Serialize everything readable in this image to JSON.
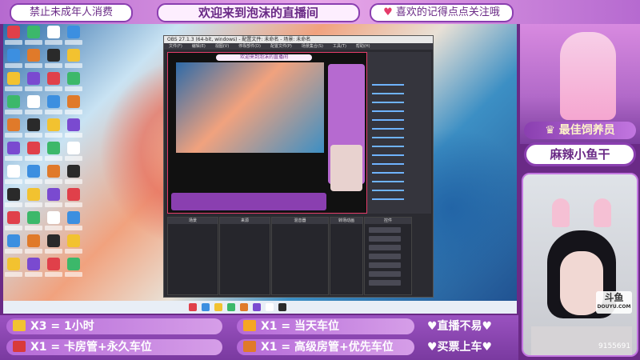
{
  "overlay": {
    "top_left_text": "禁止未成年人消费",
    "top_center_text": "欢迎来到泡沫的直播间",
    "top_right_text": "喜欢的记得点点关注哦",
    "best_fan_title": "最佳饲养员",
    "best_fan_name": "麻辣小鱼干",
    "platform_logo": "斗鱼",
    "platform_sub": "DOUYU.COM",
    "corner_number": "9155691"
  },
  "gifts": [
    {
      "icon": "gold-bar-icon",
      "text": "X3 = 1小时",
      "color": "#f2c230"
    },
    {
      "icon": "rocket-icon",
      "text": "X1 = 卡房管+永久车位",
      "color": "#d93a3a"
    },
    {
      "icon": "plane-icon",
      "text": "X1 = 当天车位",
      "color": "#f6a623"
    },
    {
      "icon": "super-rocket-icon",
      "text": "X1 = 高级房管+优先车位",
      "color": "#e07a2a"
    }
  ],
  "notes": [
    "♥直播不易♥",
    "♥买票上车♥"
  ],
  "obs": {
    "title": "OBS 27.1.3 (64-bit, windows) - 配置文件: 未命名 - 场景: 未命名",
    "menu": [
      "文件(F)",
      "编辑(E)",
      "视图(V)",
      "停靠部件(D)",
      "配置文件(P)",
      "场景集合(S)",
      "工具(T)",
      "帮助(H)"
    ],
    "preview_title": "欢迎来到泡沫的直播间",
    "panels": [
      "场景",
      "来源",
      "混音器",
      "转场动画",
      "控件"
    ]
  },
  "colors": {
    "frame_purple": "#8a3fb0",
    "accent_pink": "#e53c6a"
  }
}
